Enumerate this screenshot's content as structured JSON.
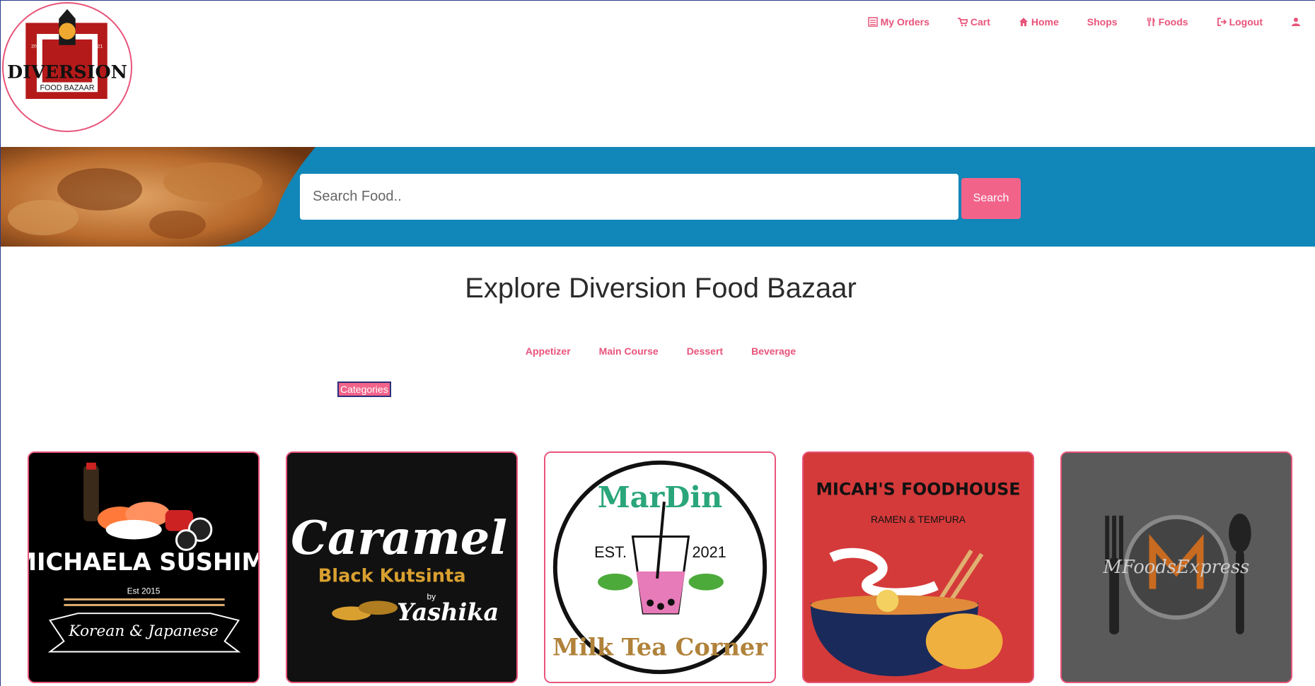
{
  "logo": {
    "line1": "DIVERSION",
    "line2": "FOOD BAZAAR",
    "year_left": "2021",
    "year_right": "2021",
    "icon": "lantern-logo-icon"
  },
  "nav": {
    "items": [
      {
        "label": "My Orders",
        "icon": "list-icon"
      },
      {
        "label": "Cart",
        "icon": "cart-icon"
      },
      {
        "label": "Home",
        "icon": "home-icon"
      },
      {
        "label": "Shops",
        "icon": ""
      },
      {
        "label": "Foods",
        "icon": "utensils-icon"
      },
      {
        "label": "Logout",
        "icon": "logout-icon"
      },
      {
        "label": "",
        "icon": "user-icon"
      }
    ]
  },
  "search": {
    "placeholder": "Search Food..",
    "button_label": "Search"
  },
  "page_title": "Explore Diversion Food Bazaar",
  "categories": {
    "items": [
      "Appetizer",
      "Main Course",
      "Dessert",
      "Beverage"
    ],
    "button_label": "Categories"
  },
  "shops": [
    {
      "name": "MICHAELA SUSHIMI",
      "est": "Est 2015",
      "tagline": "Korean & Japanese",
      "bg": "#000000"
    },
    {
      "name": "Caramel",
      "sub": "Black Kutsinta",
      "by": "by",
      "owner": "Yashika",
      "bg": "#111111"
    },
    {
      "name": "MarDin",
      "est": "EST.",
      "year": "2021",
      "tagline": "Milk Tea Corner",
      "bg": "#ffffff"
    },
    {
      "name": "MICAH'S FOODHOUSE",
      "tagline": "RAMEN & TEMPURA",
      "bg": "#d43a3a"
    },
    {
      "name": "MFoodsExpress",
      "bg": "#5a5a5a"
    }
  ],
  "colors": {
    "accent": "#e8547a",
    "banner": "#1186b8",
    "button": "#f2638a"
  }
}
